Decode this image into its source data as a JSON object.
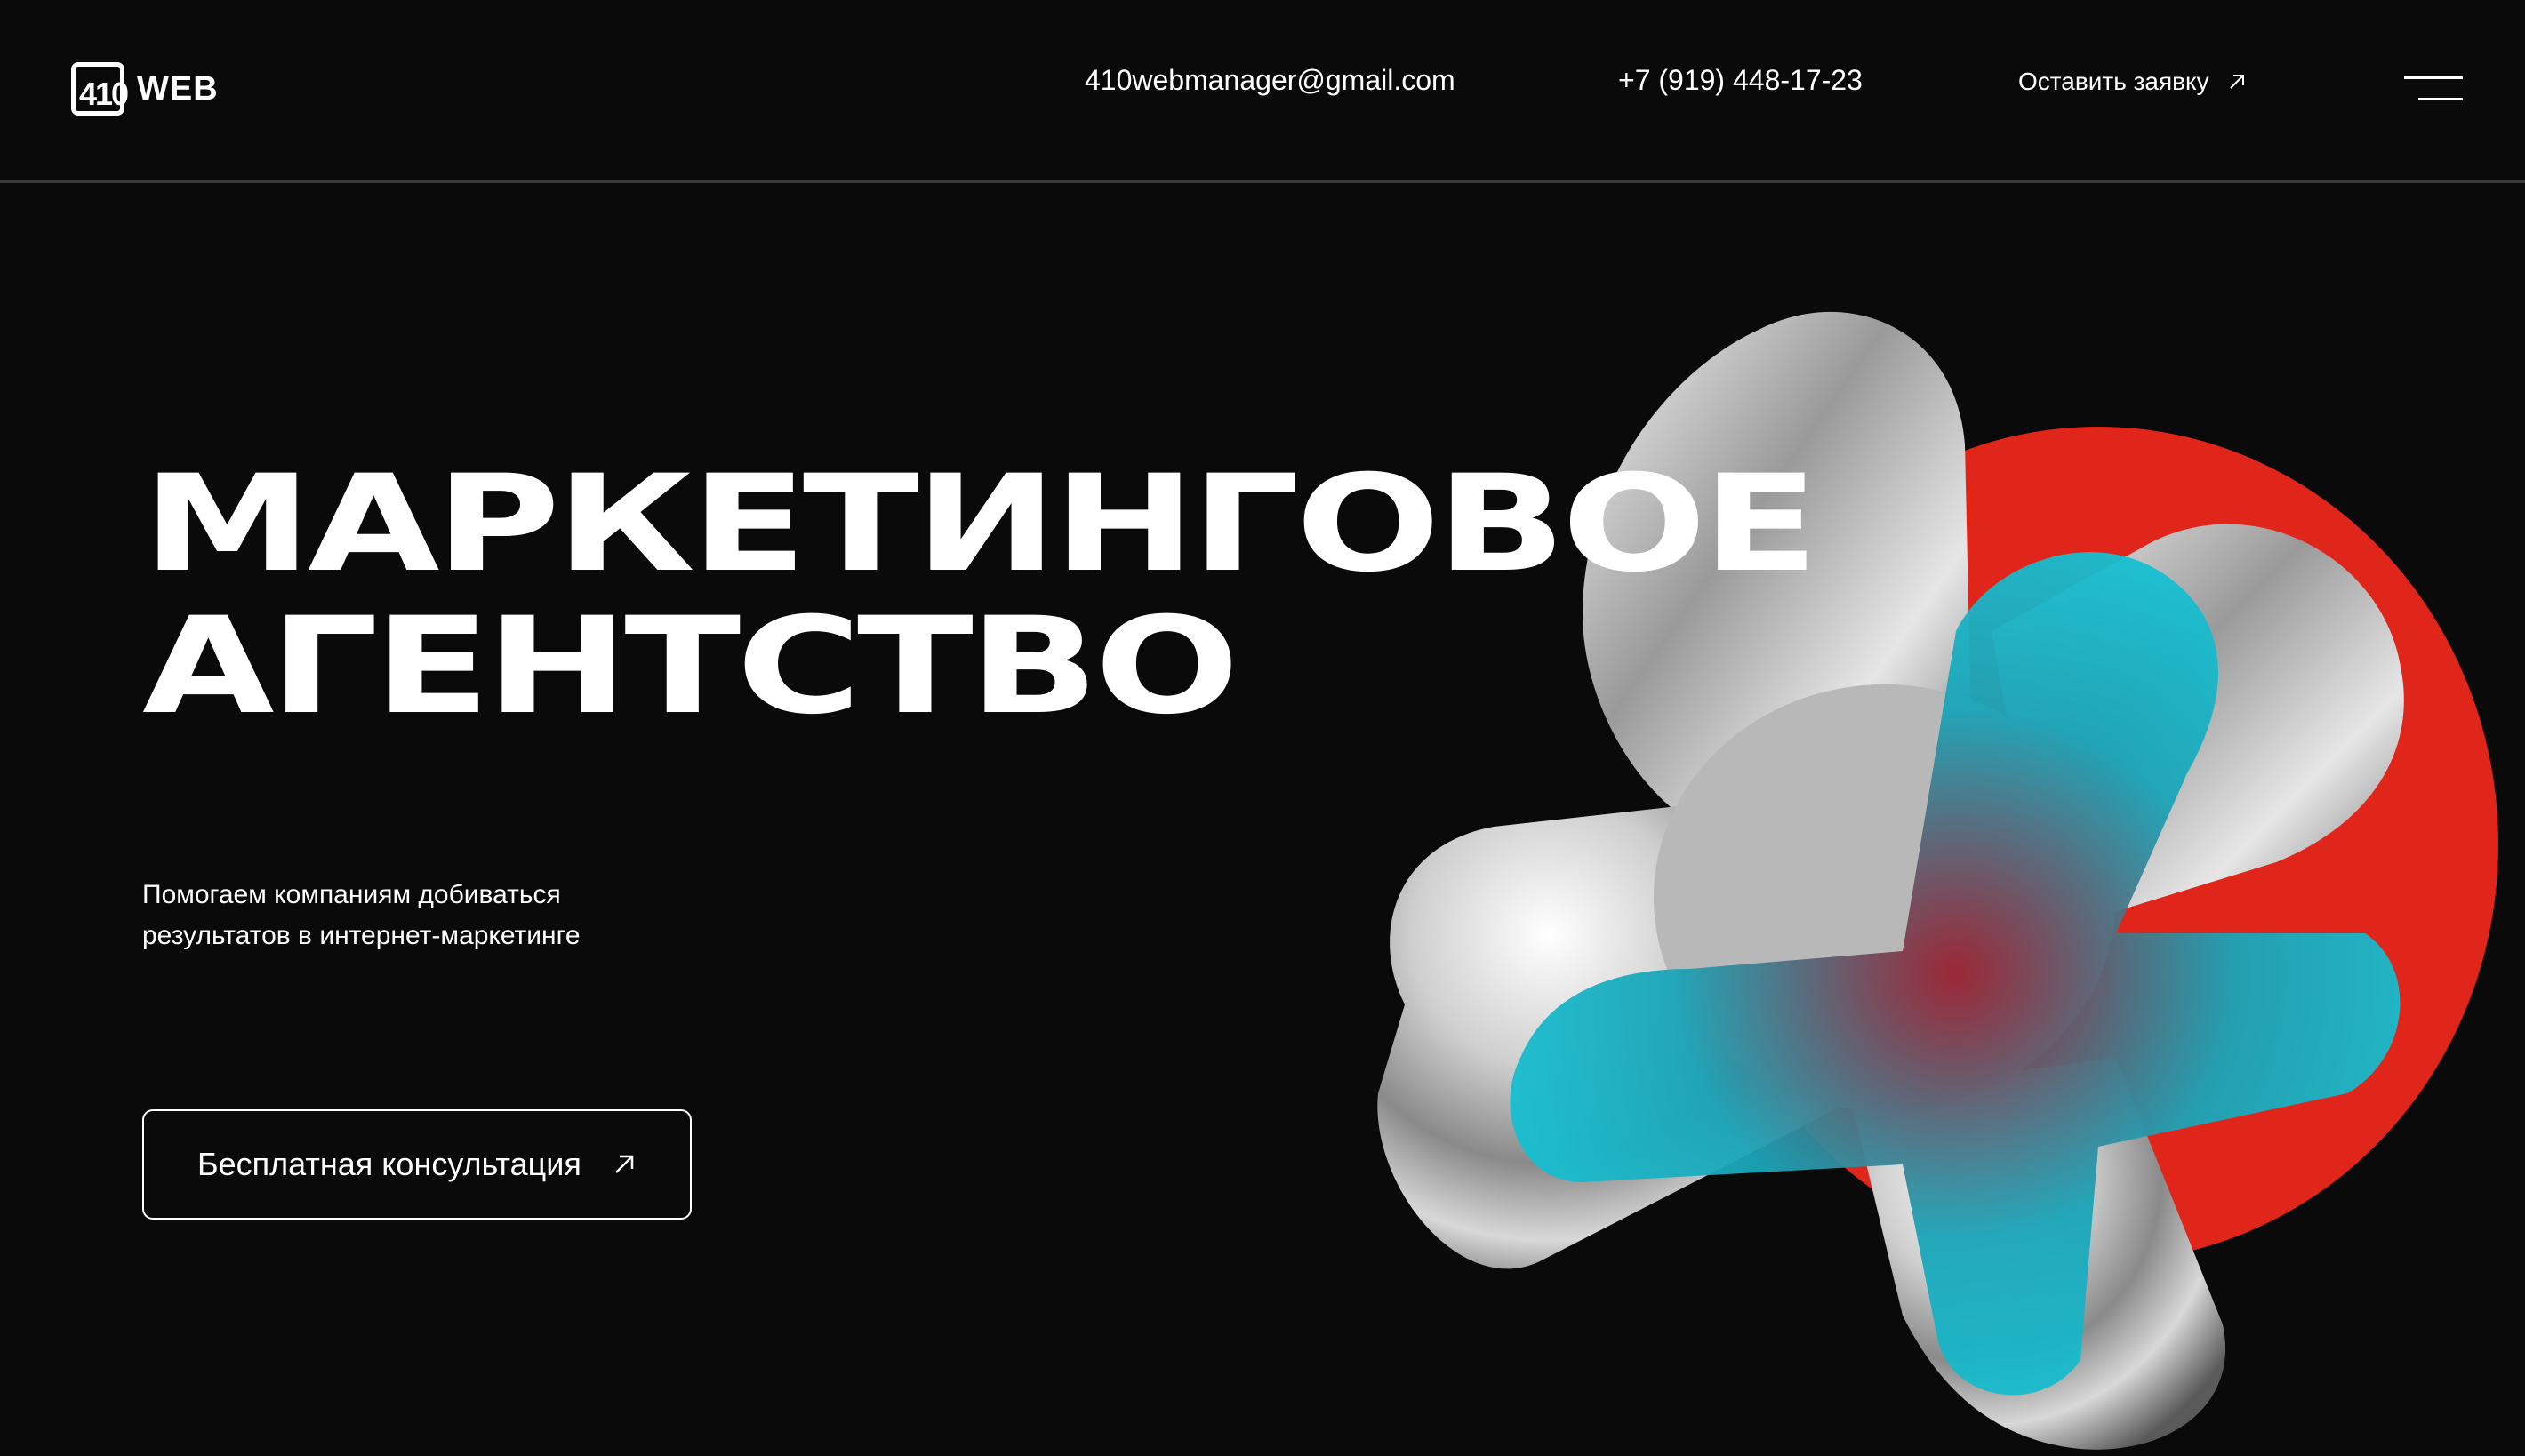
{
  "header": {
    "logo_number": "410",
    "logo_word": "WEB",
    "email": "410webmanager@gmail.com",
    "phone": "+7 (919) 448-17-23",
    "cta_label": "Оставить заявку",
    "cta_icon": "arrow-up-right-icon",
    "menu_icon": "menu-icon"
  },
  "hero": {
    "title_line1": "МАРКЕТИНГОВОЕ",
    "title_line2": "АГЕНТСТВО",
    "subtitle_line1": "Помогаем компаниям добиваться",
    "subtitle_line2": "результатов в интернет-маркетинге",
    "button_label": "Бесплатная консультация",
    "button_icon": "arrow-up-right-icon"
  },
  "colors": {
    "background": "#0a0a0a",
    "accent_red": "#e0261a",
    "accent_cyan": "#14d4e4",
    "text": "#ffffff"
  }
}
